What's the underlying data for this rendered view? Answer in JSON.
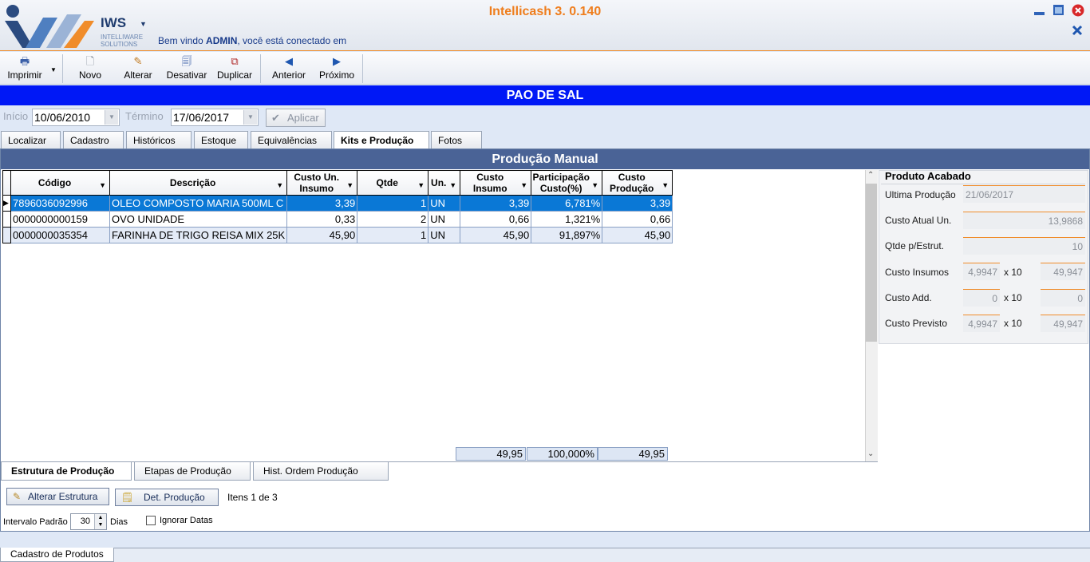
{
  "window": {
    "title": "Intellicash 3. 0.140",
    "welcome_prefix": "Bem vindo",
    "welcome_user": "ADMIN",
    "welcome_suffix": ", você está conectado em",
    "logo_name": "IWS",
    "logo_sub1": "INTELLIWARE",
    "logo_sub2": "SOLUTIONS"
  },
  "toolbar": {
    "imprimir": "Imprimir",
    "novo": "Novo",
    "alterar": "Alterar",
    "desativar": "Desativar",
    "duplicar": "Duplicar",
    "anterior": "Anterior",
    "proximo": "Próximo"
  },
  "banner": "PAO DE SAL",
  "filter": {
    "inicio_label": "Início",
    "inicio_value": "10/06/2010",
    "termino_label": "Término",
    "termino_value": "17/06/2017",
    "aplicar": "Aplicar"
  },
  "tabs": [
    "Localizar",
    "Cadastro",
    "Históricos",
    "Estoque",
    "Equivalências",
    "Kits e Produção",
    "Fotos"
  ],
  "section_title": "Produção Manual",
  "grid": {
    "headers": [
      "Código",
      "Descrição",
      "Custo Un. Insumo",
      "Qtde",
      "Un.",
      "Custo Insumo",
      "Participação Custo(%)",
      "Custo Produção"
    ],
    "rows": [
      [
        "7896036092996",
        "OLEO COMPOSTO MARIA 500ML C",
        "3,39",
        "1",
        "UN",
        "3,39",
        "6,781%",
        "3,39"
      ],
      [
        "0000000000159",
        "OVO UNIDADE",
        "0,33",
        "2",
        "UN",
        "0,66",
        "1,321%",
        "0,66"
      ],
      [
        "0000000035354",
        "FARINHA DE TRIGO REISA MIX 25K",
        "45,90",
        "1",
        "UN",
        "45,90",
        "91,897%",
        "45,90"
      ]
    ],
    "totals": {
      "custo_insumo": "49,95",
      "participacao": "100,000%",
      "custo_producao": "49,95"
    }
  },
  "produto_acabado": {
    "title": "Produto Acabado",
    "ultima_producao_label": "Ultima Produção",
    "ultima_producao_value": "21/06/2017",
    "custo_atual_label": "Custo Atual Un.",
    "custo_atual_value": "13,9868",
    "qtde_label": "Qtde p/Estrut.",
    "qtde_value": "10",
    "custo_insumos_label": "Custo Insumos",
    "custo_insumos_unit": "4,9947",
    "custo_insumos_mult": "x 10",
    "custo_insumos_total": "49,947",
    "custo_add_label": "Custo Add.",
    "custo_add_unit": "0",
    "custo_add_mult": "x 10",
    "custo_add_total": "0",
    "custo_previsto_label": "Custo Previsto",
    "custo_previsto_unit": "4,9947",
    "custo_previsto_mult": "x 10",
    "custo_previsto_total": "49,947"
  },
  "bottom_tabs": [
    "Estrutura de Produção",
    "Etapas de Produção",
    "Hist. Ordem Produção"
  ],
  "actions": {
    "alterar_estrutura": "Alterar Estrutura",
    "det_producao": "Det. Produção",
    "itens": "Itens 1 de 3",
    "intervalo_label": "Intervalo Padrão",
    "intervalo_value": "30",
    "dias": "Dias",
    "ignorar_datas": "Ignorar Datas"
  },
  "status_tab": "Cadastro de Produtos",
  "colors": {
    "banner": "#0018f6",
    "section": "#4a6396",
    "selected_row": "#0a78d6",
    "accent": "#ef7d1c"
  }
}
